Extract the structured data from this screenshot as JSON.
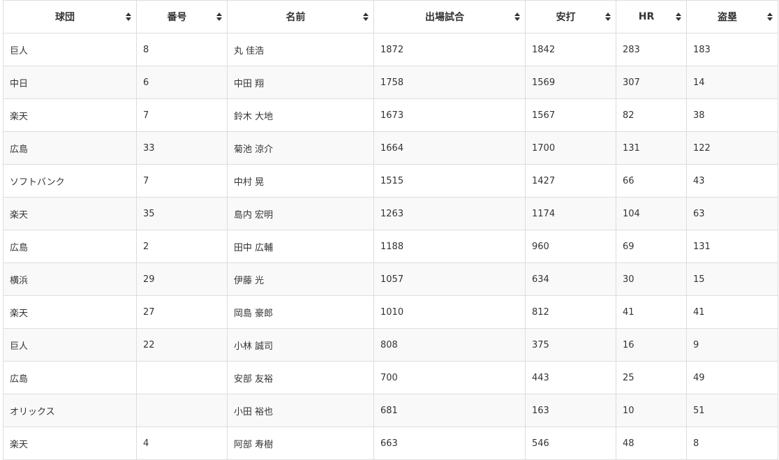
{
  "table": {
    "columns": [
      {
        "label": "球団"
      },
      {
        "label": "番号"
      },
      {
        "label": "名前"
      },
      {
        "label": "出場試合"
      },
      {
        "label": "安打"
      },
      {
        "label": "HR"
      },
      {
        "label": "盗塁"
      }
    ],
    "rows": [
      [
        "巨人",
        "8",
        "丸 佳浩",
        "1872",
        "1842",
        "283",
        "183"
      ],
      [
        "中日",
        "6",
        "中田 翔",
        "1758",
        "1569",
        "307",
        "14"
      ],
      [
        "楽天",
        "7",
        "鈴木 大地",
        "1673",
        "1567",
        "82",
        "38"
      ],
      [
        "広島",
        "33",
        "菊池 涼介",
        "1664",
        "1700",
        "131",
        "122"
      ],
      [
        "ソフトバンク",
        "7",
        "中村 晃",
        "1515",
        "1427",
        "66",
        "43"
      ],
      [
        "楽天",
        "35",
        "島内 宏明",
        "1263",
        "1174",
        "104",
        "63"
      ],
      [
        "広島",
        "2",
        "田中 広輔",
        "1188",
        "960",
        "69",
        "131"
      ],
      [
        "横浜",
        "29",
        "伊藤 光",
        "1057",
        "634",
        "30",
        "15"
      ],
      [
        "楽天",
        "27",
        "岡島 豪郎",
        "1010",
        "812",
        "41",
        "41"
      ],
      [
        "巨人",
        "22",
        "小林 誠司",
        "808",
        "375",
        "16",
        "9"
      ],
      [
        "広島",
        "",
        "安部 友裕",
        "700",
        "443",
        "25",
        "49"
      ],
      [
        "オリックス",
        "",
        "小田 裕也",
        "681",
        "163",
        "10",
        "51"
      ],
      [
        "楽天",
        "4",
        "阿部 寿樹",
        "663",
        "546",
        "48",
        "8"
      ]
    ]
  },
  "icons": {
    "sort": "sort-icon"
  },
  "colors": {
    "border": "#dddddd",
    "stripe": "#f9f9f9",
    "text": "#333333"
  }
}
